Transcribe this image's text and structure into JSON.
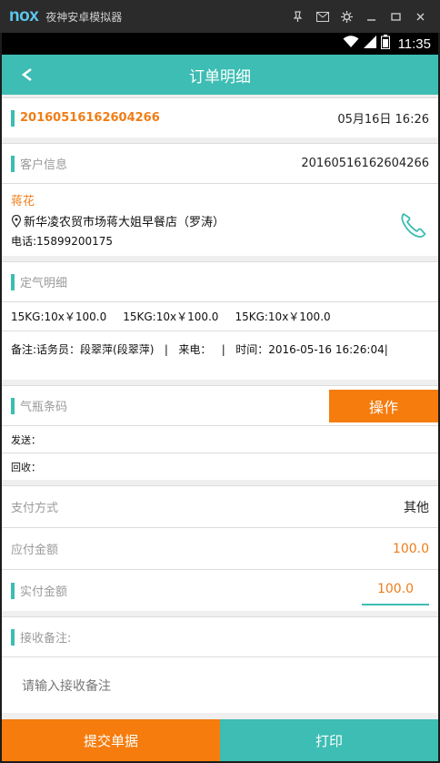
{
  "emulator": {
    "logo": "nox",
    "title": "夜神安卓模拟器",
    "icons": [
      "pin-icon",
      "mail-icon",
      "gear-icon",
      "minimize-icon",
      "maximize-icon",
      "close-icon"
    ]
  },
  "status_bar": {
    "time": "11:35",
    "icons": [
      "wifi-icon",
      "signal-icon",
      "battery-icon"
    ]
  },
  "header": {
    "title": "订单明细",
    "back_label": "<"
  },
  "order": {
    "id": "20160516162604266",
    "datetime": "05月16日 16:26"
  },
  "customer": {
    "section_label": "客户信息",
    "id": "20160516162604266",
    "name": "蒋花",
    "address": "新华凌农贸市场蒋大姐早餐店（罗涛）",
    "phone": "电话:15899200175"
  },
  "gas": {
    "section_label": "定气明细",
    "items": [
      "15KG:10x￥100.0",
      "15KG:10x￥100.0",
      "15KG:10x￥100.0"
    ],
    "remark": "备注:话务员：段翠萍(段翠萍)   |   来电：   |   时间：2016-05-16 16:26:04|"
  },
  "barcode": {
    "section_label": "气瓶条码",
    "action_label": "操作",
    "send_label": "发送：",
    "receive_label": "回收："
  },
  "payment": {
    "method_label": "支付方式",
    "method_value": "其他",
    "due_label": "应付金额",
    "due_value": "100.0",
    "paid_label": "实付金额",
    "paid_value": "100.0"
  },
  "receive_remark": {
    "label": "接收备注:",
    "placeholder": "请输入接收备注"
  },
  "actions": {
    "submit_label": "提交单据",
    "print_label": "打印"
  },
  "colors": {
    "accent": "#3dbdb3",
    "orange": "#f57c0d",
    "text_orange": "#f07d17"
  }
}
